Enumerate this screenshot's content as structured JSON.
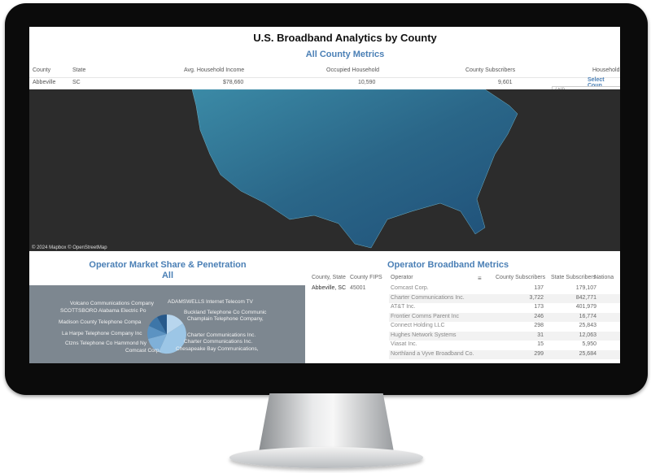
{
  "dashboard": {
    "title": "U.S. Broadband Analytics by County",
    "metrics_title": "All County Metrics",
    "columns": [
      "County",
      "State",
      "Avg. Household Income",
      "Occupied Household",
      "County Subscribers",
      "Household"
    ],
    "row": {
      "county": "Abbeville",
      "state": "SC",
      "income": "$78,660",
      "occupied": "10,590",
      "subscribers": "9,601"
    },
    "select_label": "Select Coun",
    "select_value": "(All)"
  },
  "map": {
    "credit": "© 2024 Mapbox © OpenStreetMap",
    "fill_color": "#2e6f8e",
    "background": "#2c2c2c"
  },
  "market_share": {
    "title": "Operator Market Share & Penetration",
    "subtitle": "All",
    "labels": [
      "Volcano Communications Company",
      "SCOTTSBORO Alabama Electric Po",
      "Madison County Telephone Compa",
      "La Harpe Telephone Company Inc",
      "Ctzns Telephone Co Hammond Ny",
      "Comcast Corp.",
      "ADAMSWELLS Internet Telecom TV",
      "Buckland Telephone Co Communic",
      "Champlain Telephone Company,",
      "Charter Communications Inc.",
      "Charter Communications Inc.",
      "Chesapeake Bay Communications,"
    ]
  },
  "operator_metrics": {
    "title": "Operator Broadband Metrics",
    "columns": [
      "County, State",
      "County FIPS",
      "Operator",
      "County Subscribers",
      "State Subscribers",
      "Nationa"
    ],
    "county_state": "Abbeville, SC",
    "fips": "45001",
    "rows": [
      {
        "operator": "Comcast Corp.",
        "county": "137",
        "state": "179,107"
      },
      {
        "operator": "Charter Communications Inc.",
        "county": "3,722",
        "state": "842,771"
      },
      {
        "operator": "AT&T Inc.",
        "county": "173",
        "state": "401,979"
      },
      {
        "operator": "Frontier Comms Parent Inc",
        "county": "246",
        "state": "16,774"
      },
      {
        "operator": "Connect Holding LLC",
        "county": "298",
        "state": "25,843"
      },
      {
        "operator": "Hughes Network Systems",
        "county": "31",
        "state": "12,063"
      },
      {
        "operator": "Viasat Inc.",
        "county": "15",
        "state": "5,950"
      },
      {
        "operator": "Northland a Vyve Broadband Co.",
        "county": "299",
        "state": "25,684"
      }
    ]
  }
}
